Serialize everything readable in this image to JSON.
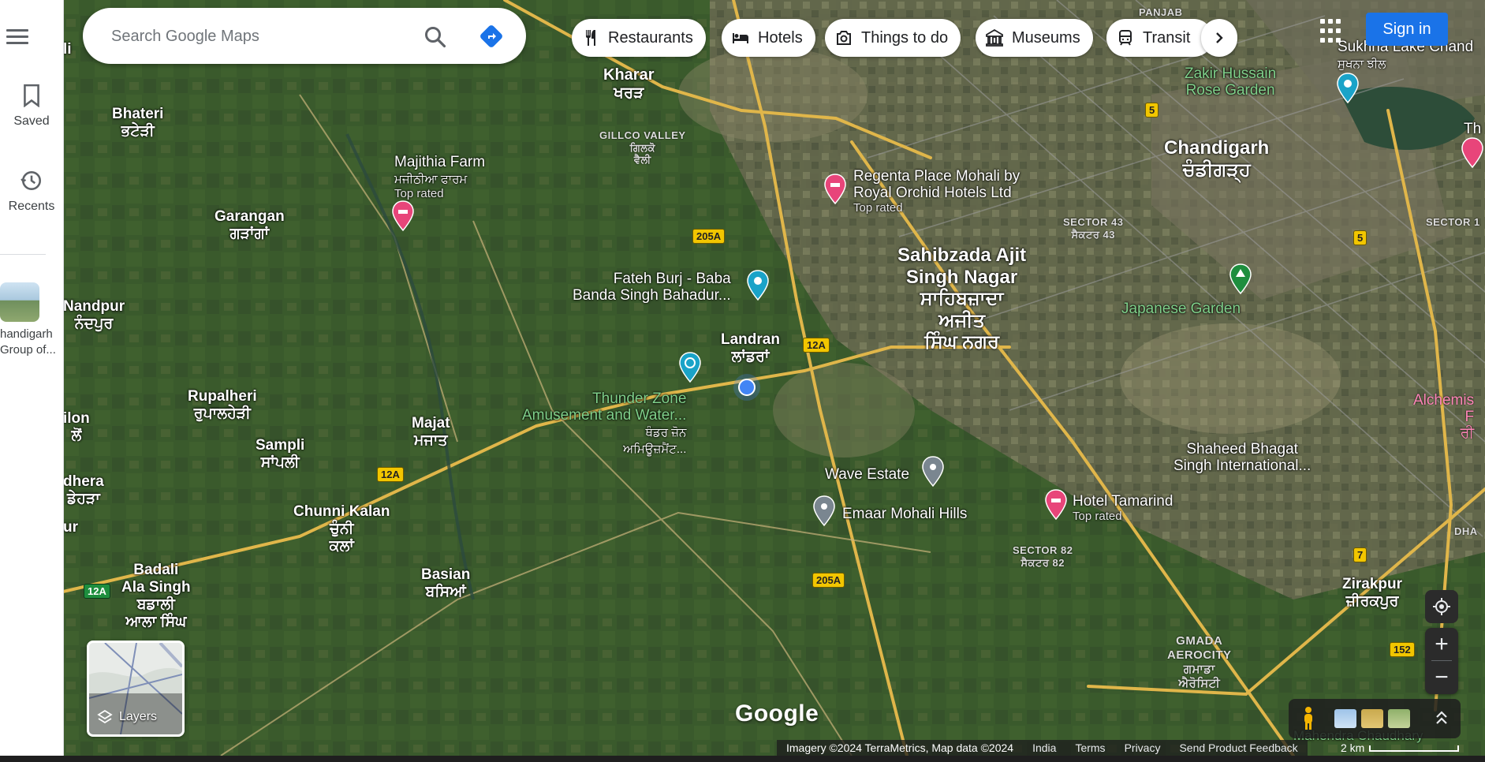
{
  "sidebar": {
    "menu_label": "Menu",
    "saved_label": "Saved",
    "recents_label": "Recents",
    "recent_place_label": "handigarh\nGroup of..."
  },
  "search": {
    "placeholder": "Search Google Maps"
  },
  "chips": [
    {
      "label": "Restaurants",
      "icon": "fork-knife-icon"
    },
    {
      "label": "Hotels",
      "icon": "bed-icon"
    },
    {
      "label": "Things to do",
      "icon": "camera-icon"
    },
    {
      "label": "Museums",
      "icon": "museum-icon"
    },
    {
      "label": "Transit",
      "icon": "train-icon"
    }
  ],
  "header": {
    "sign_in_label": "Sign in"
  },
  "map": {
    "places": [
      {
        "name": "Kharar",
        "native": "ਖਰੜ"
      },
      {
        "name": "Bhateri",
        "native": "ਭਟੇੜੀ"
      },
      {
        "name": "Garangan",
        "native": "ਗੜਾਂਗਾਂ"
      },
      {
        "name": "Nandpur",
        "native": "ਨੰਦਪੁਰ"
      },
      {
        "name": "Rupalheri",
        "native": "ਰੁਪਾਲਹੇੜੀ"
      },
      {
        "name": "Majat",
        "native": "ਮਜਾਤ"
      },
      {
        "name": "Sampli",
        "native": "ਸਾਂਪਲੀ"
      },
      {
        "name": "Chunni Kalan",
        "native": "ਚੁੰਨੀ\nਕਲਾਂ"
      },
      {
        "name": "Badali\nAla Singh",
        "native": "ਬਡਾਲੀ\nਆਲਾ ਸਿੰਘ"
      },
      {
        "name": "Basian",
        "native": "ਬਸਿਆਂ"
      },
      {
        "name": "Landran",
        "native": "ਲਾਂਡਰਾਂ"
      },
      {
        "name": "Chandigarh",
        "native": "ਚੰਡੀਗੜ੍ਹ"
      },
      {
        "name": "Sahibzada Ajit\nSingh Nagar",
        "native": "ਸਾਹਿਬਜ਼ਾਦਾ\nਅਜੀਤ\nਸਿੰਘ ਨਗਰ"
      },
      {
        "name": "Zirakpur",
        "native": "ਜ਼ੀਰਕਪੁਰ"
      },
      {
        "name": "ilon",
        "native": "ਲੋਂ"
      },
      {
        "name": "dhera",
        "native": "ਡੇਹੜਾ"
      },
      {
        "name": "ur",
        "native": ""
      },
      {
        "name": "li",
        "native": ""
      }
    ],
    "areas": [
      {
        "name": "GILLCO VALLEY",
        "native": "ਗਿਲਕੋ\nਵੈਲੀ"
      },
      {
        "name": "SECTOR 43",
        "native": "ਸੈਕਟਰ 43"
      },
      {
        "name": "SECTOR 82",
        "native": "ਸੈਕਟਰ 82"
      },
      {
        "name": "GMADA\nAEROCITY",
        "native": "ਗਮਾਡਾ\nਐਰੋਸਿਟੀ"
      },
      {
        "name": "PANJAB",
        "native": ""
      },
      {
        "name": "SECTOR 1",
        "native": ""
      },
      {
        "name": "DHA",
        "native": ""
      }
    ],
    "pois": [
      {
        "name": "Majithia Farm",
        "native": "ਮਜੀਠੀਆ ਫਾਰਮ",
        "badge": "Top rated",
        "type": "hotel"
      },
      {
        "name": "Regenta Place Mohali by\nRoyal Orchid Hotels Ltd",
        "native": "",
        "badge": "Top rated",
        "type": "hotel"
      },
      {
        "name": "Fateh Burj - Baba\nBanda Singh Bahadur...",
        "native": "",
        "badge": "",
        "type": "attraction"
      },
      {
        "name": "Thunder Zone\nAmusement and Water...",
        "native": "ਥੰਡਰ ਜ਼ੋਨ\nਅਮਿਊਜ਼ਮੈਂਟ...",
        "badge": "",
        "type": "park"
      },
      {
        "name": "Wave Estate",
        "native": "",
        "badge": "",
        "type": "place"
      },
      {
        "name": "Emaar Mohali Hills",
        "native": "",
        "badge": "",
        "type": "place"
      },
      {
        "name": "Hotel Tamarind",
        "native": "",
        "badge": "Top rated",
        "type": "hotel"
      },
      {
        "name": "Shaheed Bhagat\nSingh International...",
        "native": "",
        "badge": "",
        "type": "airport"
      },
      {
        "name": "Zakir Hussain\nRose Garden",
        "native": "",
        "badge": "",
        "type": "garden"
      },
      {
        "name": "Japanese Garden",
        "native": "",
        "badge": "",
        "type": "garden"
      },
      {
        "name": "Sukhna Lake Chand",
        "native": "ਸੁਖਨਾ ਝੀਲ",
        "badge": "",
        "type": "attraction"
      },
      {
        "name": "Alchemis",
        "native": "F\nਰੀ",
        "badge": "",
        "type": "place"
      },
      {
        "name": "Th",
        "native": "",
        "badge": "",
        "type": "hotel"
      },
      {
        "name": "Mahendra Chaudhary",
        "native": "",
        "badge": "",
        "type": "park"
      }
    ],
    "road_shields": [
      "205A",
      "12A",
      "12A",
      "12A",
      "205A",
      "5",
      "5",
      "7",
      "152"
    ]
  },
  "controls": {
    "layers_label": "Layers",
    "zoom_in": "+",
    "zoom_out": "−"
  },
  "footer": {
    "google_logo": "Google",
    "attribution": "Imagery ©2024 TerraMetrics, Map data ©2024",
    "country": "India",
    "terms": "Terms",
    "privacy": "Privacy",
    "feedback": "Send Product Feedback",
    "scale": "2 km"
  },
  "colors": {
    "accent": "#1a73e8",
    "hotel_pin": "#e8457a",
    "attraction_pin": "#1aa3c8",
    "garden_pin": "#1e8e3e",
    "place_pin": "#7a8690",
    "road": "#e0b64a"
  }
}
